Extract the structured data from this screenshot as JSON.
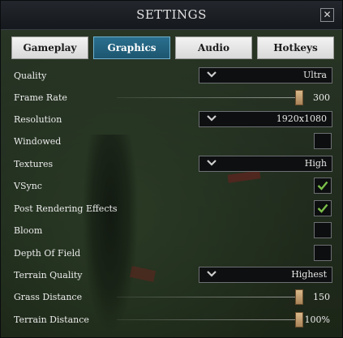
{
  "window": {
    "title": "SETTINGS",
    "close_symbol": "✕"
  },
  "tabs": [
    {
      "label": "Gameplay",
      "active": false
    },
    {
      "label": "Graphics",
      "active": true
    },
    {
      "label": "Audio",
      "active": false
    },
    {
      "label": "Hotkeys",
      "active": false
    }
  ],
  "settings": {
    "quality": {
      "label": "Quality",
      "value": "Ultra"
    },
    "frame_rate": {
      "label": "Frame Rate",
      "value": "300",
      "level": 1.0
    },
    "resolution": {
      "label": "Resolution",
      "value": "1920x1080"
    },
    "windowed": {
      "label": "Windowed",
      "checked": false
    },
    "textures": {
      "label": "Textures",
      "value": "High"
    },
    "vsync": {
      "label": "VSync",
      "checked": true
    },
    "post_rendering": {
      "label": "Post Rendering Effects",
      "checked": true
    },
    "bloom": {
      "label": "Bloom",
      "checked": false
    },
    "depth_of_field": {
      "label": "Depth Of Field",
      "checked": false
    },
    "terrain_quality": {
      "label": "Terrain Quality",
      "value": "Highest"
    },
    "grass_distance": {
      "label": "Grass Distance",
      "value": "150",
      "level": 1.0
    },
    "terrain_distance": {
      "label": "Terrain Distance",
      "value": "100%",
      "level": 1.0
    }
  },
  "icons": {
    "dropdown": "chevron-down-icon",
    "check": "checkmark-icon",
    "close": "close-icon"
  },
  "colors": {
    "accent_tab": "#1d5670",
    "check": "#7bbf4a",
    "slider_thumb": "#c2a06f"
  }
}
